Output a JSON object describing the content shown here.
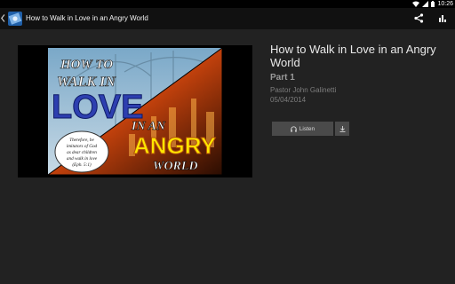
{
  "status_bar": {
    "time": "10:26"
  },
  "action_bar": {
    "title": "How to Walk in Love in an Angry World"
  },
  "cover": {
    "line1": "HOW TO",
    "line2": "WALK IN",
    "line3": "LOVE",
    "line4": "IN AN",
    "line5": "ANGRY",
    "line6": "WORLD",
    "verse": [
      "Therefore, be",
      "imitators of God",
      "as dear children",
      "and walk in love",
      "(Eph. 5:1)"
    ]
  },
  "sermon": {
    "title": "How to Walk in Love in an Angry World",
    "part": "Part 1",
    "speaker": "Pastor John Galinetti",
    "date": "05/04/2014"
  },
  "actions": {
    "listen_label": "Listen"
  },
  "colors": {
    "background": "#222222",
    "action_bar": "#111111",
    "button": "#4a4a4a"
  }
}
